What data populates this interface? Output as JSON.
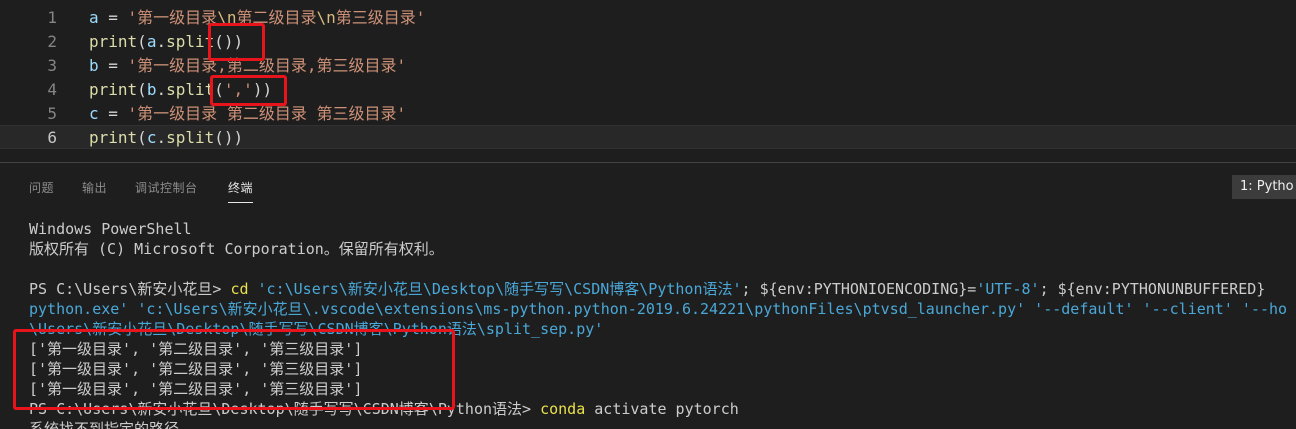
{
  "editor": {
    "lines": [
      {
        "num": "1",
        "parts": [
          [
            "var",
            "a"
          ],
          [
            "plain",
            " = "
          ],
          [
            "str",
            "'第一级目录"
          ],
          [
            "esc",
            "\\n"
          ],
          [
            "str",
            "第二级目录"
          ],
          [
            "esc",
            "\\n"
          ],
          [
            "str",
            "第三级目录'"
          ]
        ]
      },
      {
        "num": "2",
        "parts": [
          [
            "fn",
            "print"
          ],
          [
            "plain",
            "("
          ],
          [
            "var",
            "a"
          ],
          [
            "plain",
            "."
          ],
          [
            "fn",
            "split"
          ],
          [
            "plain",
            "())"
          ]
        ]
      },
      {
        "num": "3",
        "parts": [
          [
            "var",
            "b"
          ],
          [
            "plain",
            " = "
          ],
          [
            "str",
            "'第一级目录,第二级目录,第三级目录'"
          ]
        ]
      },
      {
        "num": "4",
        "parts": [
          [
            "fn",
            "print"
          ],
          [
            "plain",
            "("
          ],
          [
            "var",
            "b"
          ],
          [
            "plain",
            "."
          ],
          [
            "fn",
            "split"
          ],
          [
            "plain",
            "("
          ],
          [
            "str",
            "','"
          ],
          [
            "plain",
            "))"
          ]
        ]
      },
      {
        "num": "5",
        "parts": [
          [
            "var",
            "c"
          ],
          [
            "plain",
            " = "
          ],
          [
            "str",
            "'第一级目录 第二级目录 第三级目录'"
          ]
        ]
      },
      {
        "num": "6",
        "parts": [
          [
            "fn",
            "print"
          ],
          [
            "plain",
            "("
          ],
          [
            "var",
            "c"
          ],
          [
            "plain",
            "."
          ],
          [
            "fn",
            "split"
          ],
          [
            "plain",
            "()"
          ],
          [
            "plain",
            ")"
          ]
        ]
      }
    ]
  },
  "panel": {
    "tabs": [
      "问题",
      "输出",
      "调试控制台",
      "终端"
    ],
    "active_tab": "终端",
    "terminal_selector": "1: Pytho"
  },
  "terminal": {
    "lines": [
      [
        [
          "def",
          "Windows PowerShell"
        ]
      ],
      [
        [
          "def",
          "版权所有 (C) Microsoft Corporation。保留所有权利。"
        ]
      ],
      [
        [
          "def",
          ""
        ]
      ],
      [
        [
          "def",
          "PS C:\\Users\\新安小花旦> "
        ],
        [
          "cmd",
          "cd"
        ],
        [
          "def",
          " "
        ],
        [
          "str",
          "'c:\\Users\\新安小花旦\\Desktop\\随手写写\\CSDN博客\\Python语法'"
        ],
        [
          "def",
          "; ${env:PYTHONIOENCODING}="
        ],
        [
          "str",
          "'UTF-8'"
        ],
        [
          "def",
          "; ${env:PYTHONUNBUFFERED}"
        ]
      ],
      [
        [
          "str",
          "python.exe' 'c:\\Users\\新安小花旦\\.vscode\\extensions\\ms-python.python-2019.6.24221\\pythonFiles\\ptvsd_launcher.py' '--default' '--client' '--ho"
        ]
      ],
      [
        [
          "str",
          "\\Users\\新安小花旦\\Desktop\\随手写写\\CSDN博客\\Python语法\\split_sep.py'"
        ]
      ],
      [
        [
          "def",
          "['第一级目录', '第二级目录', '第三级目录']"
        ]
      ],
      [
        [
          "def",
          "['第一级目录', '第二级目录', '第三级目录']"
        ]
      ],
      [
        [
          "def",
          "['第一级目录', '第二级目录', '第三级目录']"
        ]
      ],
      [
        [
          "def",
          "PS C:\\Users\\新安小花旦\\Desktop\\随手写写\\CSDN博客\\Python语法> "
        ],
        [
          "cmd",
          "conda"
        ],
        [
          "def",
          " activate pytorch"
        ]
      ],
      [
        [
          "def",
          "系统找不到指定的路径。"
        ]
      ]
    ]
  },
  "colors": {
    "highlight_box": "#e8141c",
    "background": "#1e1e1e"
  }
}
